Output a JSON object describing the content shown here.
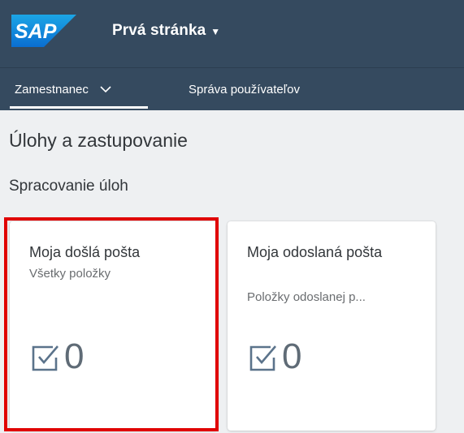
{
  "shell": {
    "logo_text": "SAP",
    "page_menu_label": "Prvá stránka",
    "page_menu_caret": "▼"
  },
  "nav": {
    "items": [
      {
        "label": "Zamestnanec"
      },
      {
        "label": "Správa používateľov"
      }
    ]
  },
  "content": {
    "section_title": "Úlohy a zastupovanie",
    "group_title": "Spracovanie úloh",
    "tiles": [
      {
        "title": "Moja došlá pošta",
        "subtitle": "Všetky položky",
        "count": "0",
        "icon": "task-checkbox-icon"
      },
      {
        "title": "Moja odoslaná pošta",
        "subtitle": "Položky odoslanej p...",
        "count": "0",
        "icon": "task-checkbox-icon"
      }
    ]
  },
  "colors": {
    "shell_bg": "#354a5f",
    "highlight": "#e00000",
    "icon": "#5b738b"
  }
}
